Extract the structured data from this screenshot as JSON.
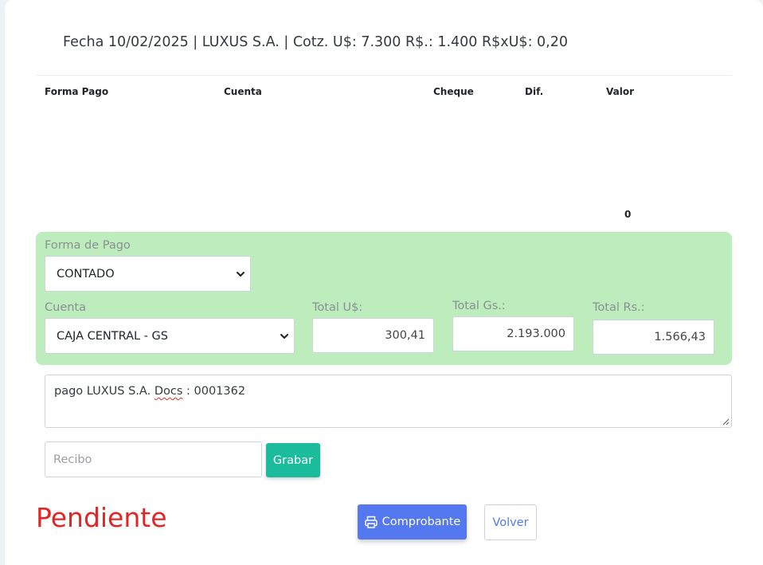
{
  "header": {
    "title": "Fecha 10/02/2025 | LUXUS S.A. | Cotz. U$: 7.300 R$.: 1.400 R$xU$: 0,20"
  },
  "table": {
    "columns": [
      "Forma Pago",
      "Cuenta",
      "Cheque",
      "Dif.",
      "Valor"
    ],
    "total_value": "0"
  },
  "payment_form": {
    "forma_pago_label": "Forma de Pago",
    "forma_pago_value": "CONTADO",
    "cuenta_label": "Cuenta",
    "cuenta_value": "CAJA CENTRAL - GS",
    "total_usd_label": "Total U$:",
    "total_usd_value": "300,41",
    "total_gs_label": "Total Gs.:",
    "total_gs_value": "2.193.000",
    "total_rs_label": "Total Rs.:",
    "total_rs_value": "1.566,43"
  },
  "note": {
    "text_before": "pago LUXUS S.A. ",
    "text_marked": "Docs",
    "text_after": " : 0001362"
  },
  "recibo": {
    "placeholder": "Recibo"
  },
  "buttons": {
    "grabar": "Grabar",
    "comprobante": "Comprobante",
    "volver": "Volver"
  },
  "status": {
    "text": "Pendiente",
    "color": "#e42525"
  },
  "colors": {
    "panel_bg": "#bdedbd",
    "grabar_bg": "#1abc9c",
    "primary": "#5478f0"
  },
  "icons": {
    "comprobante": "printer-icon",
    "select_arrow": "chevron-down-icon"
  }
}
